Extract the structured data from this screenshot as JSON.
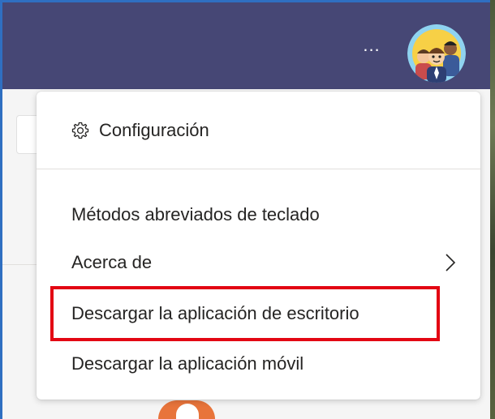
{
  "header": {
    "more_label": "...",
    "avatar_icon": "team-avatar-icon",
    "bar_color": "#464775"
  },
  "menu": {
    "settings": {
      "icon": "gear-icon",
      "label": "Configuración"
    },
    "items": [
      {
        "label": "Métodos abreviados de teclado"
      },
      {
        "label": "Acerca de",
        "icon": "chevron-right-icon"
      },
      {
        "label": "Descargar la aplicación de escritorio",
        "highlighted": true
      },
      {
        "label": "Descargar la aplicación móvil"
      }
    ]
  },
  "annotation": {
    "highlight_color": "#e30613"
  }
}
